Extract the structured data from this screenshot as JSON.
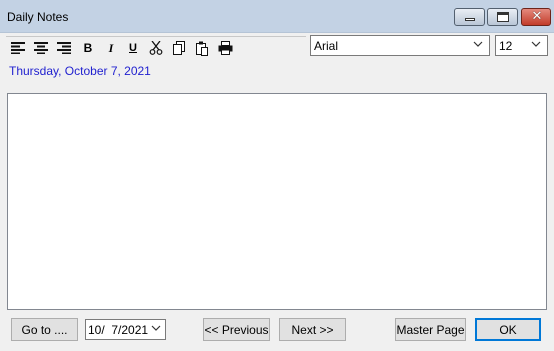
{
  "window": {
    "title": "Daily Notes",
    "controls": {
      "minimize_icon": "minimize-icon",
      "maximize_icon": "maximize-icon",
      "close_glyph": "✕"
    }
  },
  "toolbar": {
    "icons": [
      "align-left-icon",
      "align-center-icon",
      "align-right-icon",
      "bold-icon",
      "italic-icon",
      "underline-icon",
      "cut-icon",
      "copy-icon",
      "paste-icon",
      "print-icon"
    ],
    "bold_glyph": "B",
    "italic_glyph": "I",
    "underline_glyph": "U",
    "font_value": "Arial",
    "size_value": "12"
  },
  "header": {
    "date": "Thursday, October 7, 2021",
    "date_color": "#1f1fcf"
  },
  "notes": {
    "text": ""
  },
  "footer": {
    "goto_label": "Go to ....",
    "date_value": "10/  7/2021",
    "previous_label": "<< Previous",
    "next_label": "Next >>",
    "master_label": "Master Page",
    "ok_label": "OK"
  },
  "colors": {
    "titlebar": "#c3d2e4",
    "ok_border": "#0078d7"
  }
}
